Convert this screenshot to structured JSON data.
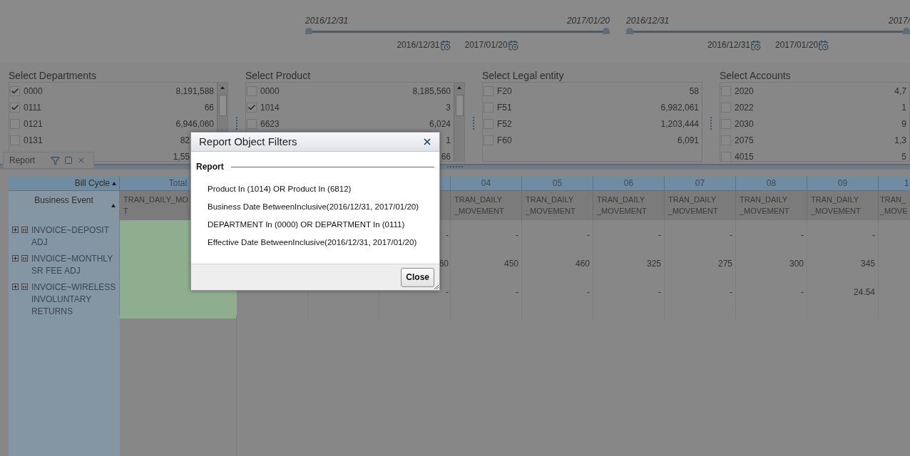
{
  "sliders": [
    {
      "start_label": "2016/12/31",
      "end_label": "2017/01/20",
      "from": "2016/12/31",
      "to": "2017/01/20"
    },
    {
      "start_label": "2016/12/31",
      "end_label": "2017/",
      "from": "2016/12/31",
      "to": "2017/01/20"
    }
  ],
  "selectors": [
    {
      "title": "Select Departments",
      "scrollbar": true,
      "items": [
        {
          "label": "0000",
          "count": "8,191,588",
          "checked": true
        },
        {
          "label": "0111",
          "count": "66",
          "checked": true
        },
        {
          "label": "0121",
          "count": "6,946,060",
          "checked": false
        },
        {
          "label": "0131",
          "count": "82",
          "checked": false,
          "kind": "cut"
        },
        {
          "count": "1,55",
          "kind": "cut"
        }
      ]
    },
    {
      "title": "Select Product",
      "scrollbar": true,
      "items": [
        {
          "label": "0000",
          "count": "8,185,560",
          "checked": false
        },
        {
          "label": "1014",
          "count": "3",
          "checked": true
        },
        {
          "label": "6623",
          "count": "6,024",
          "checked": false
        },
        {
          "count": "1"
        },
        {
          "count": "66"
        }
      ]
    },
    {
      "title": "Select Legal entity",
      "scrollbar": false,
      "items": [
        {
          "label": "F20",
          "count": "58",
          "checked": false
        },
        {
          "label": "F51",
          "count": "6,982,061",
          "checked": false
        },
        {
          "label": "F52",
          "count": "1,203,444",
          "checked": false
        },
        {
          "label": "F60",
          "count": "6,091",
          "checked": false
        }
      ]
    },
    {
      "title": "Select Accounts",
      "scrollbar": false,
      "items": [
        {
          "label": "2020",
          "count": "4,7",
          "checked": false
        },
        {
          "label": "2022",
          "count": "1",
          "checked": false
        },
        {
          "label": "2030",
          "count": "9",
          "checked": false
        },
        {
          "label": "2075",
          "count": "1,3",
          "checked": false
        },
        {
          "label": "4015",
          "count": "5",
          "checked": false
        }
      ]
    }
  ],
  "report_tab": {
    "label": "Report"
  },
  "table": {
    "row_header": "Bill Cycle",
    "row_subheader": "Business Event",
    "columns": [
      {
        "label": "Total",
        "sub": [
          "TRAN_DAILY_MO",
          "T"
        ]
      },
      {},
      {},
      {},
      {
        "label": "04",
        "sub": [
          "TRAN_DAILY",
          "_MOVEMENT"
        ]
      },
      {
        "label": "05",
        "sub": [
          "TRAN_DAILY",
          "_MOVEMENT"
        ]
      },
      {
        "label": "06",
        "sub": [
          "TRAN_DAILY",
          "_MOVEMENT"
        ]
      },
      {
        "label": "07",
        "sub": [
          "TRAN_DAILY",
          "_MOVEMENT"
        ]
      },
      {
        "label": "08",
        "sub": [
          "TRAN_DAILY",
          "_MOVEMENT"
        ]
      },
      {
        "label": "09",
        "sub": [
          "TRAN_DAILY",
          "_MOVEMENT"
        ]
      },
      {
        "label": "1",
        "sub": [
          "TRAN_",
          "_MOVE"
        ]
      }
    ],
    "rows": [
      {
        "label": "INVOICE~DEPOSIT ADJ",
        "cells": [
          null,
          null,
          null,
          "-",
          "-",
          "-",
          "-",
          "-",
          "-",
          "-",
          null
        ]
      },
      {
        "label": "INVOICE~MONTHLY SR FEE ADJ",
        "cells": [
          null,
          null,
          null,
          "60",
          "450",
          "460",
          "325",
          "275",
          "300",
          "345",
          null
        ]
      },
      {
        "label": "INVOICE~WIRELESS INVOLUNTARY RETURNS",
        "cells": [
          null,
          null,
          null,
          "-",
          "-",
          "-",
          "-",
          "-",
          "-",
          "24.54",
          null
        ]
      }
    ]
  },
  "dialog": {
    "title": "Report Object Filters",
    "section": "Report",
    "filters": [
      "Product In (1014) OR Product In (6812)",
      "Business Date BetweenInclusive(2016/12/31, 2017/01/20)",
      "DEPARTMENT In (0000) OR DEPARTMENT In (0111)",
      "Effective Date BetweenInclusive(2016/12/31, 2017/01/20)"
    ],
    "button": "Close"
  }
}
